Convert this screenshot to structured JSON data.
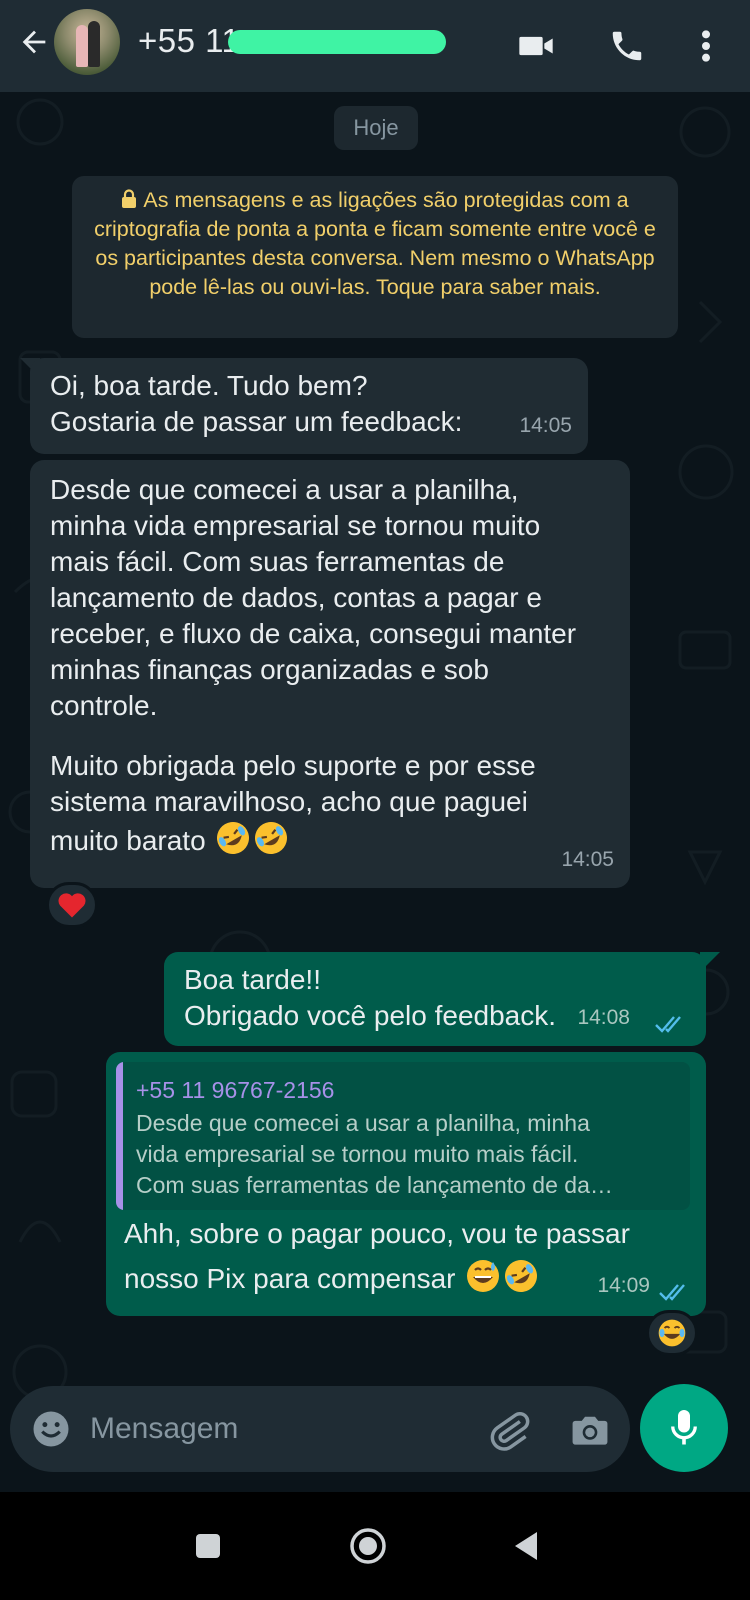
{
  "header": {
    "contact_name": "+55 11",
    "icons": {
      "back": "arrow-left-icon",
      "video": "video-camera-icon",
      "call": "phone-icon",
      "menu": "more-vertical-icon"
    }
  },
  "chat": {
    "date_chip": "Hoje",
    "encryption_notice": "As mensagens e as ligações são protegidas com a criptografia de ponta a ponta e ficam somente entre você e os participantes desta conversa. Nem mesmo o WhatsApp pode lê-las ou ouvi-las. Toque para saber mais.",
    "messages": [
      {
        "direction": "in",
        "text": "Oi, boa tarde. Tudo bem?\nGostaria de passar um feedback:",
        "time": "14:05"
      },
      {
        "direction": "in",
        "text_p1": "Desde que comecei a usar a planilha,\nminha vida empresarial se tornou muito\nmais fácil. Com suas ferramentas de\nlançamento de dados, contas a pagar e\nreceber, e fluxo de caixa, consegui manter\nminhas finanças organizadas e sob\ncontrole.",
        "text_p2": "Muito obrigada pelo suporte e por esse\nsistema maravilhoso, acho que paguei",
        "text_p3": "muito barato",
        "emojis": [
          "rolling-on-floor-laughing-emoji",
          "rolling-on-floor-laughing-emoji"
        ],
        "time": "14:05",
        "reaction": "red-heart-emoji"
      },
      {
        "direction": "out",
        "text": "Boa tarde!!\nObrigado você pelo feedback.",
        "time": "14:08",
        "status": "read"
      },
      {
        "direction": "out",
        "quote": {
          "author": "+55 11 96767-2156",
          "lines": [
            "Desde que comecei a usar a planilha, minha",
            "vida empresarial se tornou muito mais fácil.",
            "Com suas ferramentas de lançamento de da…"
          ]
        },
        "text_line1": "Ahh, sobre o pagar pouco, vou te passar",
        "text_line2": "nosso Pix para compensar",
        "emojis": [
          "grinning-sweat-emoji",
          "rolling-on-floor-laughing-emoji"
        ],
        "time": "14:09",
        "status": "read",
        "reaction": "face-with-tears-of-joy-emoji"
      }
    ]
  },
  "composer": {
    "placeholder": "Mensagem",
    "icons": {
      "emoji": "smiley-icon",
      "attach": "paperclip-icon",
      "camera": "camera-icon",
      "mic": "microphone-icon"
    }
  },
  "navbar": {
    "icons": [
      "recents-square-icon",
      "home-circle-icon",
      "back-triangle-icon"
    ]
  },
  "colors": {
    "header_bg": "#1f2c34",
    "chat_bg": "#0b141a",
    "incoming_bubble": "#202c33",
    "outgoing_bubble": "#005c4b",
    "accent": "#00a884",
    "notice_text": "#f1cf6a",
    "read_ticks": "#53bdeb",
    "redaction": "#3ff3a4"
  }
}
